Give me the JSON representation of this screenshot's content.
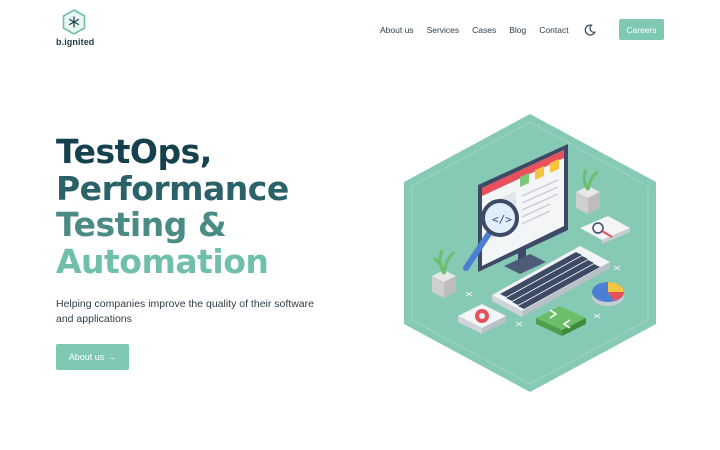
{
  "brand": {
    "name": "b.ignited",
    "accent": "#7ec8b4"
  },
  "nav": {
    "items": [
      {
        "label": "About us"
      },
      {
        "label": "Services"
      },
      {
        "label": "Cases"
      },
      {
        "label": "Blog"
      },
      {
        "label": "Contact"
      }
    ],
    "theme_icon": "moon-icon",
    "cta_label": "Careers"
  },
  "hero": {
    "title_lines": [
      "TestOps,",
      "Performance",
      "Testing &",
      "Automation"
    ],
    "title_colors": [
      "#15404d",
      "#2b6168",
      "#4a8c85",
      "#6fbfaa"
    ],
    "subtitle": "Helping companies improve the quality of their software and applications",
    "button_label": "About us",
    "button_icon": "arrow-right-icon"
  },
  "illustration": {
    "description_icon": "isometric-testing-illustration",
    "hexagon_color": "#86c9b5"
  }
}
